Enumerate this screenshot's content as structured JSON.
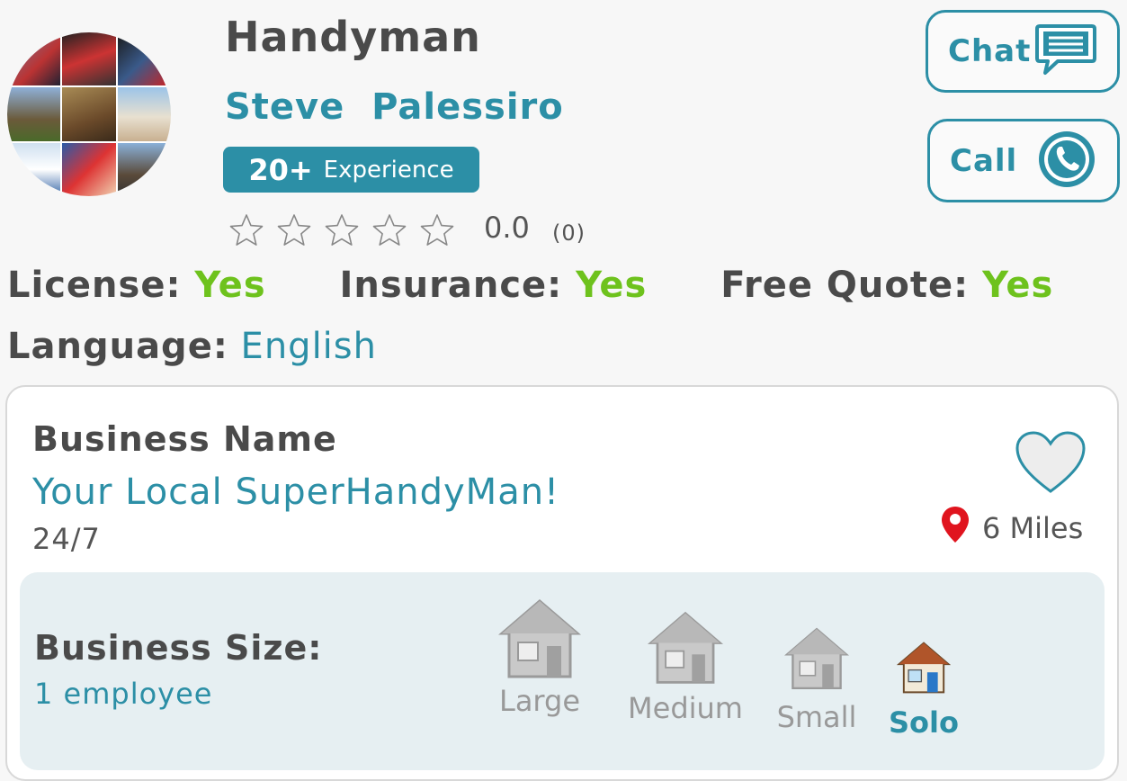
{
  "profile": {
    "category": "Handyman",
    "first_name": "Steve",
    "last_name": "Palessiro",
    "experience_number": "20+",
    "experience_label": "Experience",
    "rating_value": "0.0",
    "rating_count": "(0)",
    "stars_filled": 0,
    "stars_total": 5
  },
  "actions": {
    "chat_label": "Chat",
    "call_label": "Call"
  },
  "facts": {
    "license_label": "License:",
    "license_value": "Yes",
    "insurance_label": "Insurance:",
    "insurance_value": "Yes",
    "free_quote_label": "Free Quote:",
    "free_quote_value": "Yes",
    "language_label": "Language:",
    "language_value": "English"
  },
  "business": {
    "name_label": "Business Name",
    "name": "Your Local SuperHandyMan!",
    "hours": "24/7",
    "distance": "6 Miles",
    "size_label": "Business Size:",
    "size_value": "1 employee",
    "size_options": [
      "Large",
      "Medium",
      "Small",
      "Solo"
    ],
    "size_selected": "Solo"
  },
  "colors": {
    "accent": "#2c8fa6",
    "yes": "#6ec21d",
    "pin": "#e0141e"
  },
  "icons": {
    "chat": "chat-bubble-icon",
    "call": "phone-icon",
    "favorite": "heart-icon",
    "location": "map-pin-icon",
    "size": "house-icon"
  }
}
